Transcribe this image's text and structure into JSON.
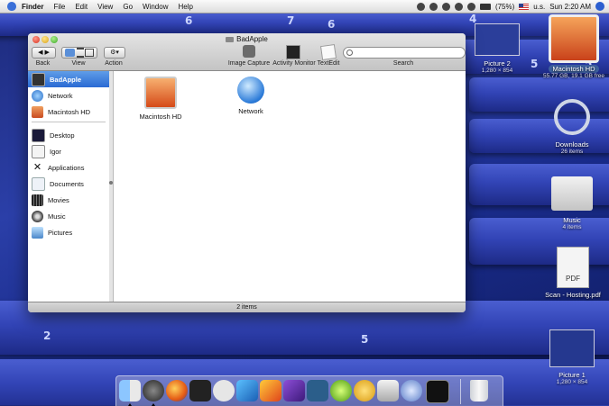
{
  "menubar": {
    "app_name": "Finder",
    "menus": [
      "File",
      "Edit",
      "View",
      "Go",
      "Window",
      "Help"
    ],
    "battery": "(75%)",
    "input_locale": "u.s.",
    "clock": "Sun 2:20 AM"
  },
  "window": {
    "title": "BadApple",
    "toolbar": {
      "back_label": "Back",
      "view_label": "View",
      "action_label": "Action",
      "image_capture_label": "Image Capture",
      "activity_monitor_label": "Activity Monitor",
      "textedit_label": "TextEdit",
      "search_label": "Search",
      "search_placeholder": ""
    },
    "sidebar": {
      "devices": [
        {
          "label": "BadApple",
          "icon": "computer-icon",
          "selected": true
        },
        {
          "label": "Network",
          "icon": "globe-icon"
        },
        {
          "label": "Macintosh HD",
          "icon": "hard-drive-icon"
        }
      ],
      "places": [
        {
          "label": "Desktop",
          "icon": "desktop-icon"
        },
        {
          "label": "Igor",
          "icon": "home-icon"
        },
        {
          "label": "Applications",
          "icon": "applications-icon"
        },
        {
          "label": "Documents",
          "icon": "documents-icon"
        },
        {
          "label": "Movies",
          "icon": "movies-icon"
        },
        {
          "label": "Music",
          "icon": "music-icon"
        },
        {
          "label": "Pictures",
          "icon": "pictures-icon"
        }
      ]
    },
    "items": [
      {
        "label": "Macintosh HD",
        "icon": "hard-drive-icon"
      },
      {
        "label": "Network",
        "icon": "globe-icon"
      }
    ],
    "status": "2 items"
  },
  "desktop": {
    "icons": [
      {
        "label": "Picture 2",
        "sub": "1,280 × 854"
      },
      {
        "label": "Macintosh HD",
        "sub": "55.77 GB, 19.1 GB free"
      },
      {
        "label": "Downloads",
        "sub": "26 items"
      },
      {
        "label": "Music",
        "sub": "4 items"
      },
      {
        "label": "Scan - Hosting.pdf",
        "sub": "",
        "badge": "PDF"
      },
      {
        "label": "Picture 1",
        "sub": "1,280 × 854"
      }
    ],
    "seat_numbers": [
      "6",
      "6",
      "5",
      "5",
      "4",
      "7",
      "2",
      "5"
    ]
  },
  "dock": {
    "apps": [
      "finder-icon",
      "dashboard-icon",
      "firefox-icon",
      "ichat-icon",
      "speech-bubble-icon",
      "quill-icon",
      "app-icon-orange",
      "app-icon-purple",
      "app-icon-green-star",
      "dreamweaver-icon",
      "flash-icon",
      "printer-icon",
      "itunes-icon",
      "terminal-icon",
      "trash-icon"
    ]
  },
  "colors": {
    "selection": "#2a6ad3",
    "desktop": "#2b3fa8"
  }
}
